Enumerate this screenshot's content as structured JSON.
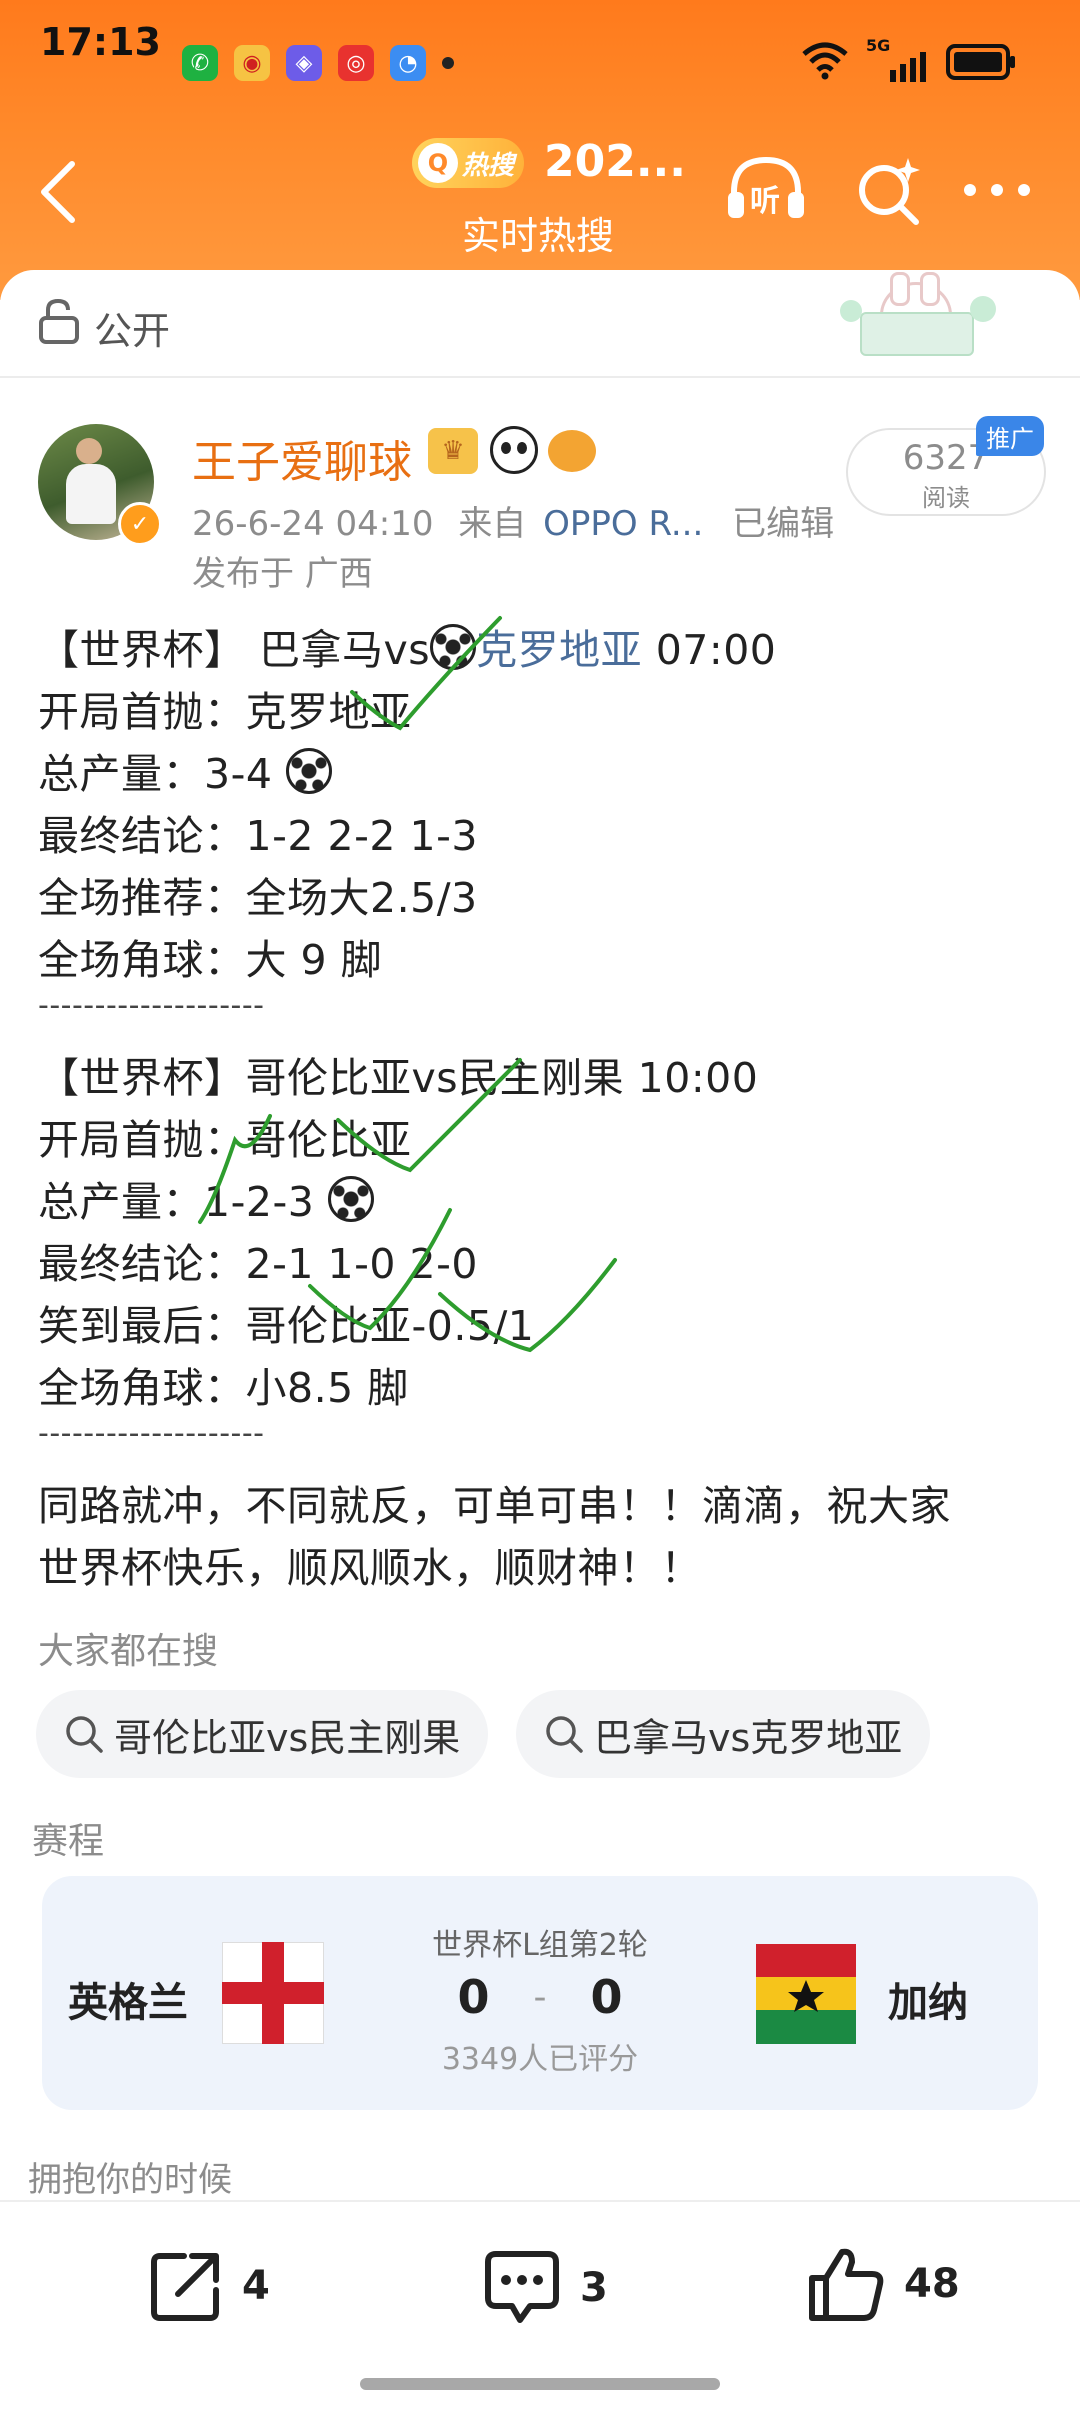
{
  "status_bar": {
    "time": "17:13",
    "network": "5G"
  },
  "header": {
    "hot_badge": "热搜",
    "title": "202...",
    "subtitle": "实时热搜",
    "listen_label": "听"
  },
  "privacy": {
    "label": "公开"
  },
  "author": {
    "name": "王子爱聊球",
    "meta_time": "26-6-24 04:10",
    "meta_from": "来自",
    "meta_device": "OPPO R...",
    "meta_edited": "已编辑",
    "location": "发布于 广西",
    "read_count": "6327",
    "read_label": "阅读",
    "promo_badge": "推广"
  },
  "post": {
    "m1_title_a": "【世界杯】 巴拿马vs",
    "m1_title_link": "克罗地亚",
    "m1_title_time": " 07:00",
    "m1_first": "开局首抛：克罗地亚",
    "m1_total": "总产量：3-4",
    "m1_final": "最终结论：1-2 2-2 1-3",
    "m1_rec": "全场推荐：全场大2.5/3",
    "m1_corner": "全场角球：大 9 脚",
    "sep1": "--------------------",
    "m2_title": "【世界杯】哥伦比亚vs民主刚果 10:00",
    "m2_first": "开局首抛：哥伦比亚",
    "m2_total": "总产量：1-2-3",
    "m2_final": "最终结论：2-1 1-0 2-0",
    "m2_last": "笑到最后：哥伦比亚-0.5/1",
    "m2_corner": "全场角球：小8.5 脚",
    "sep2": "--------------------",
    "closing_1": "同路就冲，不同就反，可单可串！！滴滴，祝大家",
    "closing_2": "世界杯快乐，顺风顺水，顺财神！！"
  },
  "search": {
    "heading": "大家都在搜",
    "chips": [
      "哥伦比亚vs民主刚果",
      "巴拿马vs克罗地亚"
    ]
  },
  "schedule": {
    "heading": "赛程",
    "home_team": "英格兰",
    "away_team": "加纳",
    "stage": "世界杯L组第2轮",
    "home_score": "0",
    "score_sep": "-",
    "away_score": "0",
    "rated": "3349人已评分"
  },
  "next_hint": "拥抱你的时候",
  "actions": {
    "share_count": "4",
    "comment_count": "3",
    "like_count": "48"
  },
  "colors": {
    "header_orange": "#ff8a2b",
    "author_name": "#e86f12",
    "link_blue": "#4a6d9a",
    "check_green": "#2e9d2e"
  }
}
